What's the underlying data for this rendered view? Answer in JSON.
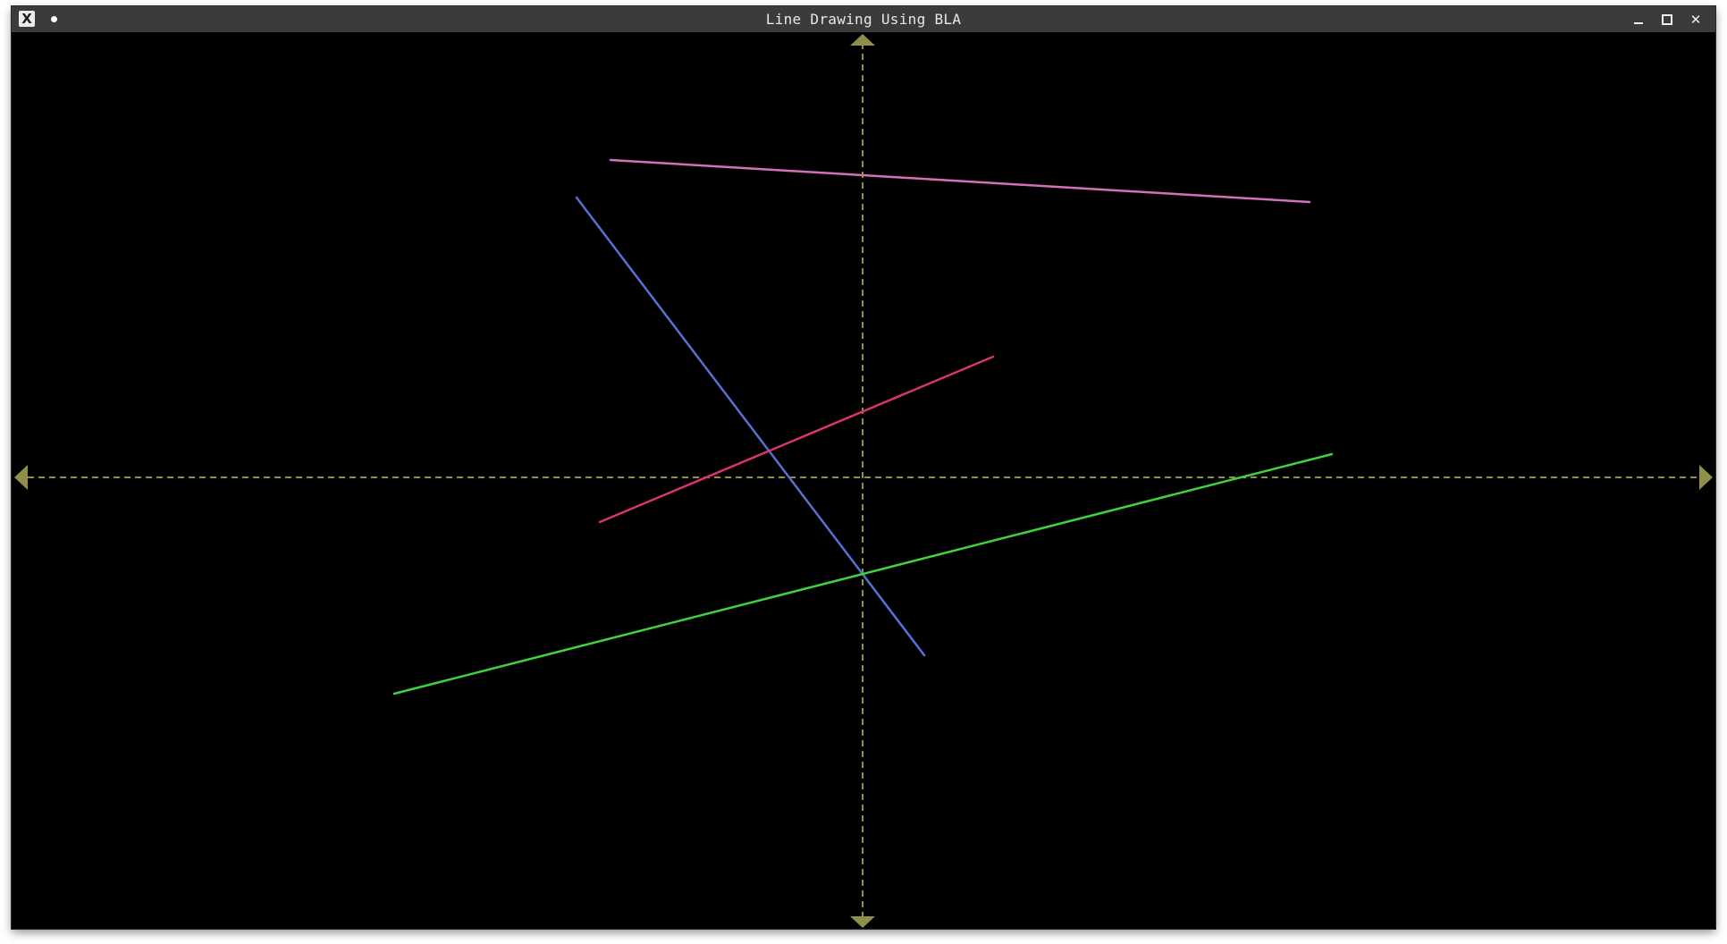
{
  "window": {
    "title": "Line Drawing Using BLA",
    "app_icon": "x-window-icon",
    "controls": {
      "minimize_icon": "minimize-icon",
      "maximize_icon": "maximize-icon",
      "close_label": "✕"
    }
  },
  "colors": {
    "canvas_background": "#000000",
    "axes": "#8f8f47",
    "line_pink": "#d36fbd",
    "line_blue": "#5a6fd4",
    "line_red": "#d8356f",
    "line_green": "#3ed43e"
  }
}
